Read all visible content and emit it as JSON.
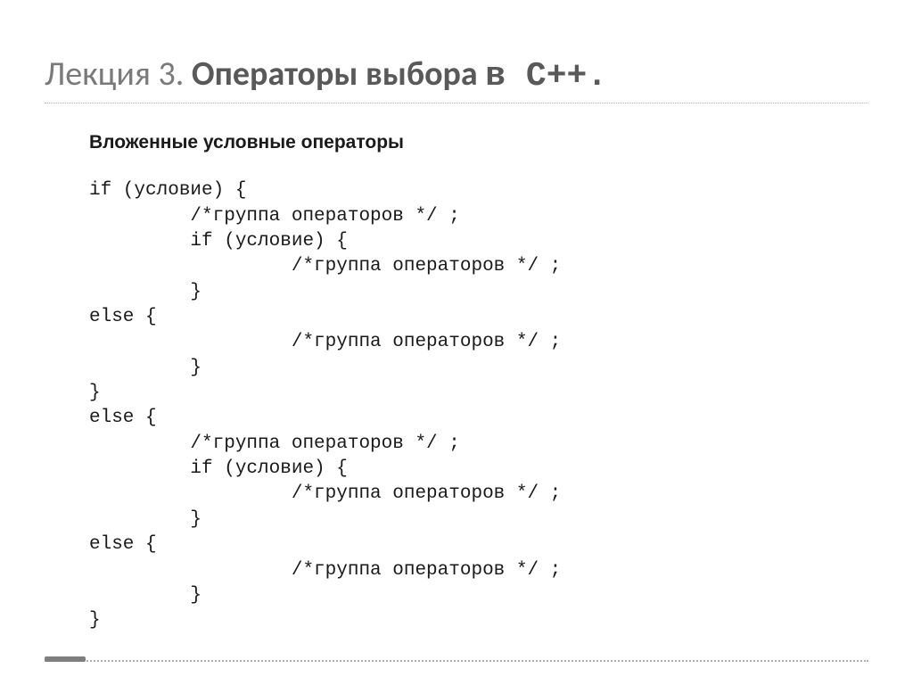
{
  "title": {
    "prefix_light": "Лекция 3. ",
    "strong": "Операторы выбора ",
    "mono": "в С++."
  },
  "subtitle": "Вложенные условные операторы",
  "code_lines": [
    "if (условие) {",
    "         /*группа операторов */ ;",
    "         if (условие) {",
    "                  /*группа операторов */ ;",
    "         }",
    "else {",
    "                  /*группа операторов */ ;",
    "         }",
    "}",
    "else {",
    "         /*группа операторов */ ;",
    "         if (условие) {",
    "                  /*группа операторов */ ;",
    "         }",
    "else {",
    "                  /*группа операторов */ ;",
    "         }",
    "}"
  ]
}
